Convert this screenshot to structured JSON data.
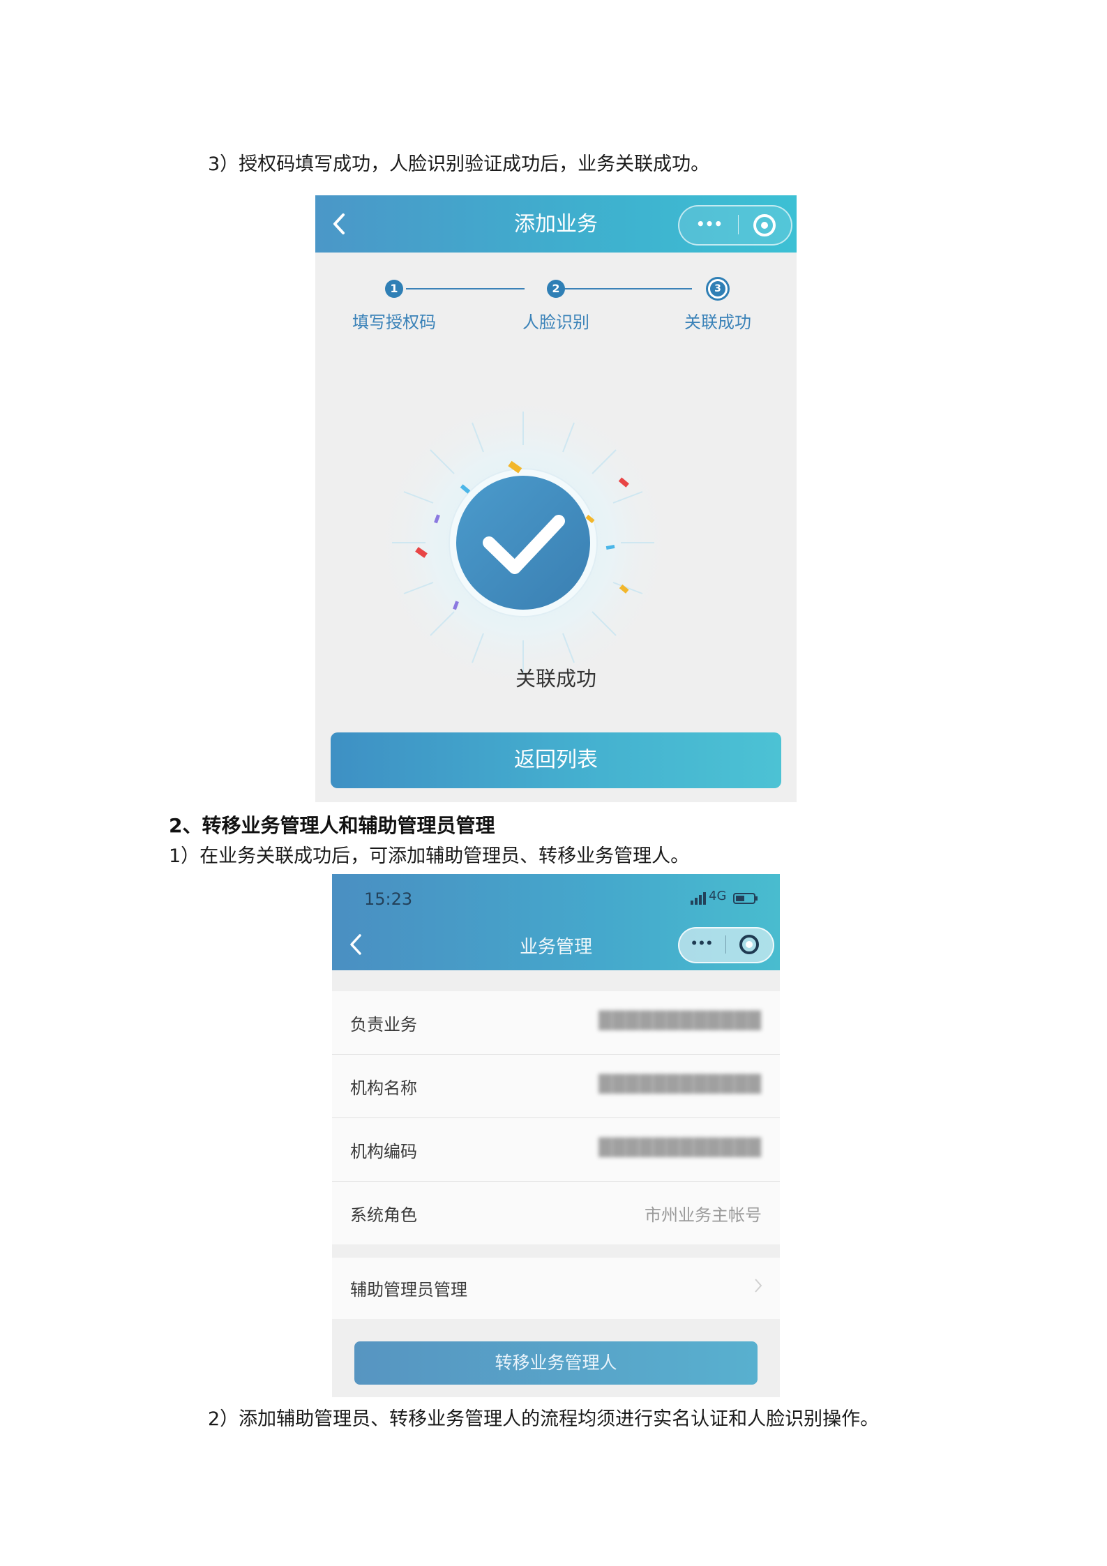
{
  "doc": {
    "para_step3": "3）授权码填写成功，人脸识别验证成功后，业务关联成功。",
    "heading_2": "2、转移业务管理人和辅助管理员管理",
    "para_2_1": "1）在业务关联成功后，可添加辅助管理员、转移业务管理人。",
    "para_2_2": "2）添加辅助管理员、转移业务管理人的流程均须进行实名认证和人脸识别操作。"
  },
  "screen1": {
    "nav_title": "添加业务",
    "capsule_dots": "•••",
    "steps": [
      {
        "num": "1",
        "label": "填写授权码"
      },
      {
        "num": "2",
        "label": "人脸识别"
      },
      {
        "num": "3",
        "label": "关联成功"
      }
    ],
    "result_text": "关联成功",
    "button_label": "返回列表",
    "colors": {
      "accent": "#3aa6cf",
      "step": "#2f7fb5",
      "check_circle": "#3d86b8"
    }
  },
  "screen2": {
    "status_time": "15:23",
    "network": "4G",
    "nav_title": "业务管理",
    "capsule_dots": "•••",
    "rows": [
      {
        "label": "负责业务",
        "value": "████████████"
      },
      {
        "label": "机构名称",
        "value": "████████████"
      },
      {
        "label": "机构编码",
        "value": "████████████"
      },
      {
        "label": "系统角色",
        "value": "市州业务主帐号"
      }
    ],
    "menu_label": "辅助管理员管理",
    "button_label": "转移业务管理人"
  }
}
